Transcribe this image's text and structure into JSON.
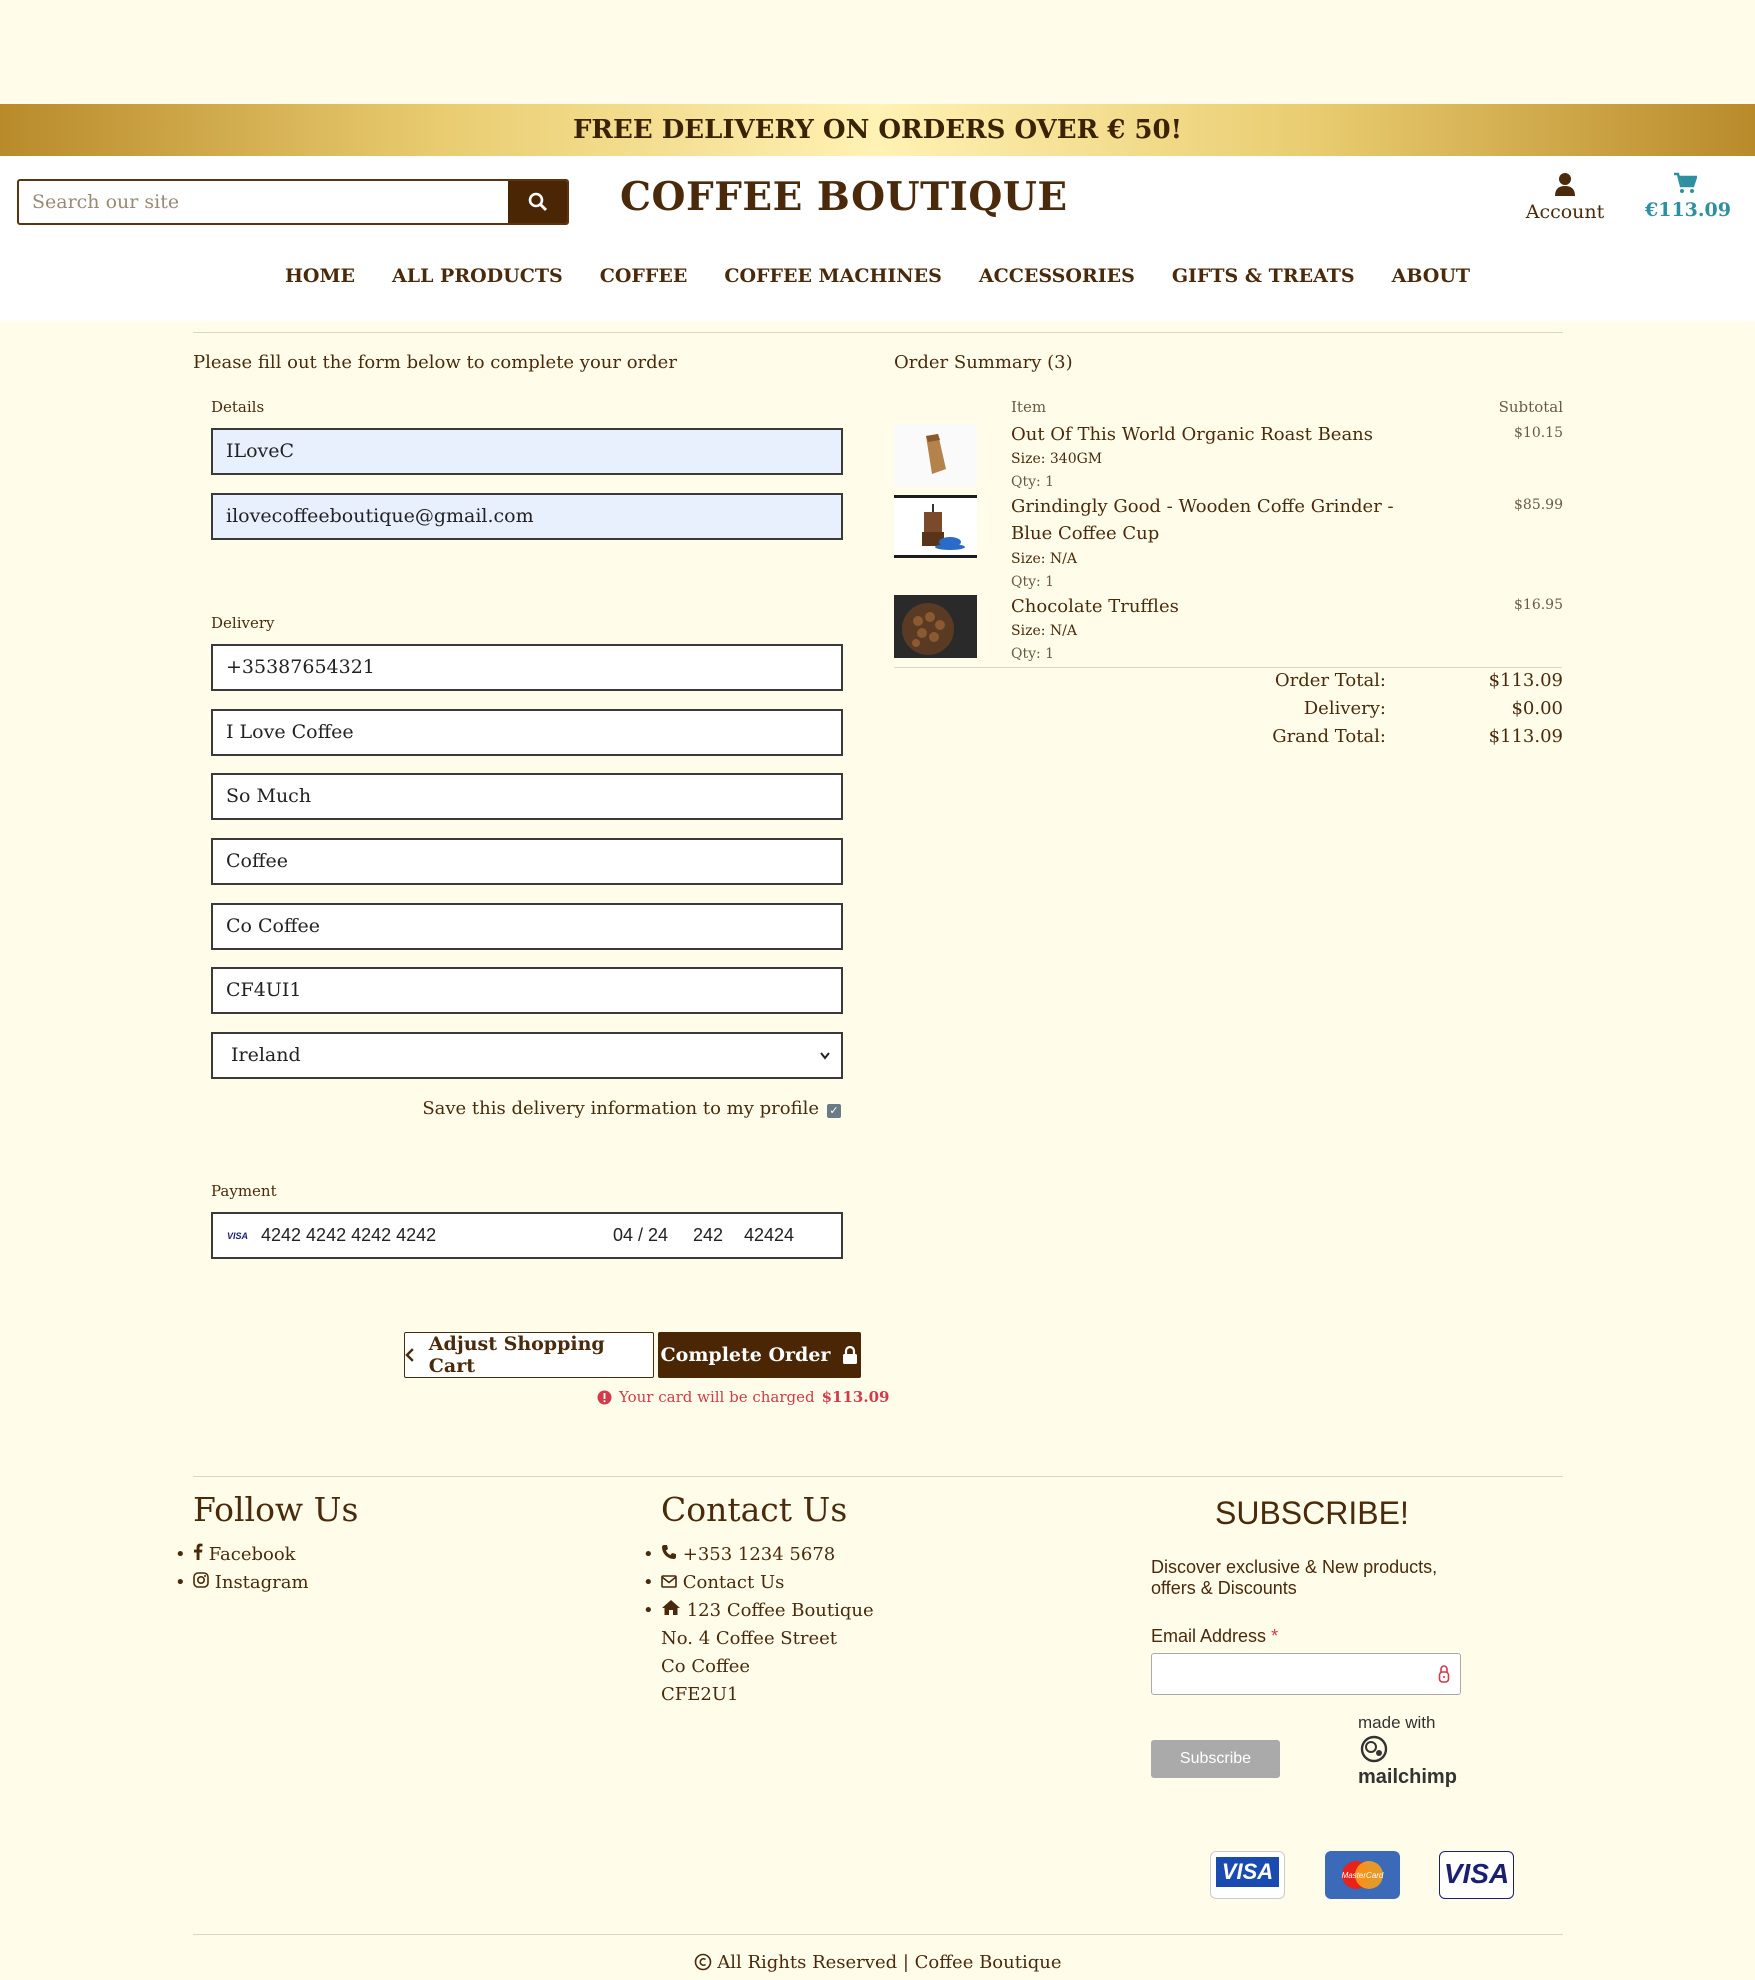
{
  "banner": {
    "text": "FREE DELIVERY ON ORDERS OVER € 50!"
  },
  "header": {
    "search_placeholder": "Search our site",
    "logo": "COFFEE BOUTIQUE",
    "account_label": "Account",
    "cart_total": "€113.09"
  },
  "nav": [
    "HOME",
    "ALL PRODUCTS",
    "COFFEE",
    "COFFEE MACHINES",
    "ACCESSORIES",
    "GIFTS & TREATS",
    "ABOUT"
  ],
  "form": {
    "intro": "Please fill out the form below to complete your order",
    "details_label": "Details",
    "details": [
      "ILoveC",
      "ilovecoffeeboutique@gmail.com"
    ],
    "delivery_label": "Delivery",
    "delivery": [
      "+35387654321",
      "I Love Coffee",
      "So Much",
      "Coffee",
      "Co Coffee",
      "CF4UI1"
    ],
    "country": "Ireland",
    "save_label": "Save this delivery information to my profile",
    "payment_label": "Payment",
    "card": {
      "number": "4242 4242 4242 4242",
      "expiry": "04 / 24",
      "cvc": "242",
      "zip": "42424"
    },
    "adjust_button": "Adjust Shopping Cart",
    "complete_button": "Complete Order",
    "charge_text": "Your card will be charged",
    "charge_amount": "$113.09"
  },
  "summary": {
    "title": "Order Summary (3)",
    "item_header": "Item",
    "subtotal_header": "Subtotal",
    "items": [
      {
        "name": "Out Of This World Organic Roast Beans",
        "name2": "",
        "size": "Size: 340GM",
        "qty": "Qty: 1",
        "price": "$10.15"
      },
      {
        "name": "Grindingly Good - Wooden Coffe Grinder -",
        "name2": "Blue Coffee Cup",
        "size": "Size: N/A",
        "qty": "Qty: 1",
        "price": "$85.99"
      },
      {
        "name": "Chocolate Truffles",
        "name2": "",
        "size": "Size: N/A",
        "qty": "Qty: 1",
        "price": "$16.95"
      }
    ],
    "order_total_label": "Order Total:",
    "order_total": "$113.09",
    "delivery_label": "Delivery:",
    "delivery": "$0.00",
    "grand_total_label": "Grand Total:",
    "grand_total": "$113.09"
  },
  "footer": {
    "follow_title": "Follow Us",
    "follow": [
      "Facebook",
      "Instagram"
    ],
    "contact_title": "Contact Us",
    "phone": "+353 1234 5678",
    "contact_link": "Contact Us",
    "address": [
      "123 Coffee Boutique",
      "No. 4 Coffee Street",
      "Co Coffee",
      "CFE2U1"
    ],
    "subscribe_title": "SUBSCRIBE!",
    "subscribe_text1": "Discover exclusive & New products,",
    "subscribe_text2": "offers & Discounts",
    "email_label": "Email Address",
    "required_mark": "*",
    "subscribe_button": "Subscribe",
    "made_with": "made with",
    "mailchimp": "mailchimp",
    "copyright": "All Rights Reserved",
    "brand": "Coffee Boutique"
  },
  "payment_cards": [
    "VISA",
    "MasterCard",
    "VISA"
  ],
  "colors": {
    "accent": "#4a2605",
    "cart": "#2d8fa0",
    "warning": "#d33a4a"
  }
}
